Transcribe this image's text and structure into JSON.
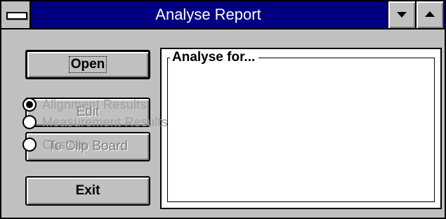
{
  "window": {
    "title": "Analyse Report"
  },
  "buttons": {
    "open": "Open",
    "edit": "Edit",
    "to_clip_board": "To Clip Board",
    "exit": "Exit"
  },
  "group": {
    "label": "Analyse for...",
    "options": [
      {
        "label": "Alignment Results",
        "selected": true,
        "enabled": false
      },
      {
        "label": "Measurement Results",
        "selected": false,
        "enabled": false
      },
      {
        "label": "Custom",
        "selected": false,
        "enabled": false
      }
    ]
  },
  "icons": {
    "system_menu": "system-menu-icon",
    "minimize": "minimize-arrow-icon",
    "maximize": "maximize-arrow-icon",
    "radio_selected": "radio-selected-icon",
    "radio_unselected": "radio-unselected-icon"
  },
  "colors": {
    "titlebar": "#000080",
    "window_face": "#c0c0c0",
    "disabled_text": "#a0a0a0",
    "panel_background": "#ffffff"
  }
}
